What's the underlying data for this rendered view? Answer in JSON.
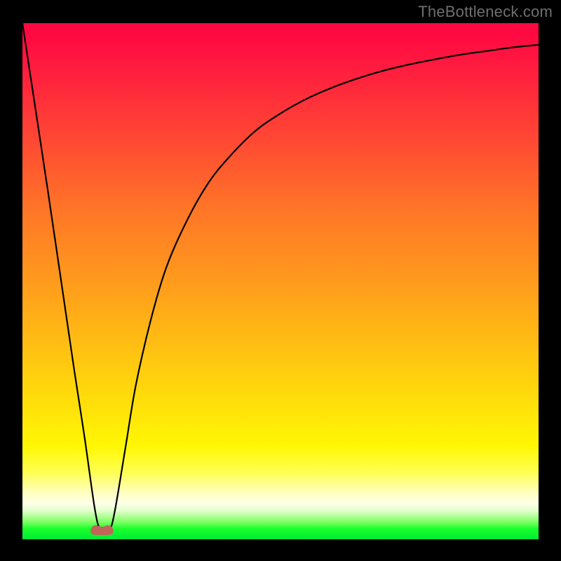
{
  "watermark": "TheBottleneck.com",
  "chart_data": {
    "type": "line",
    "title": "",
    "xlabel": "",
    "ylabel": "",
    "xlim": [
      0,
      100
    ],
    "ylim": [
      0,
      100
    ],
    "grid": false,
    "legend": false,
    "series": [
      {
        "name": "bottleneck-curve",
        "color": "#000000",
        "x": [
          0,
          5,
          10,
          12,
          14,
          15,
          16,
          17,
          18,
          20,
          22,
          25,
          28,
          32,
          36,
          40,
          45,
          50,
          55,
          60,
          65,
          70,
          75,
          80,
          85,
          90,
          95,
          100
        ],
        "values": [
          100,
          67,
          33,
          20,
          6,
          2,
          2,
          2,
          6,
          18,
          30,
          43,
          53,
          62,
          69,
          74,
          79,
          82.5,
          85.3,
          87.5,
          89.3,
          90.8,
          92,
          93,
          93.9,
          94.6,
          95.3,
          95.8
        ]
      }
    ],
    "marker": {
      "name": "optimum-marker",
      "color": "#c1645a",
      "x_range": [
        13.2,
        17.6
      ],
      "y": 1.5,
      "shape": "rounded-bar"
    },
    "background_gradient": {
      "top_color": "#ff0941",
      "bottom_color": "#00eb36",
      "orientation": "vertical"
    }
  }
}
